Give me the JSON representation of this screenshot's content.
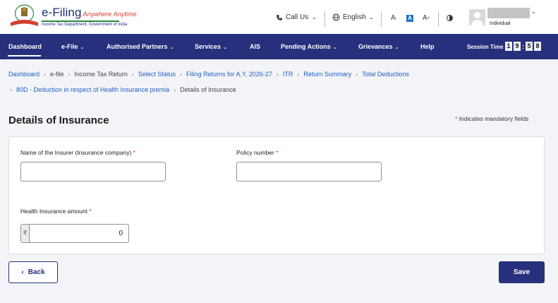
{
  "header": {
    "brand_title": "e-Filing",
    "brand_tagline": "Anywhere Anytime",
    "brand_subtitle": "Income Tax Department, Government of India",
    "call_us": "Call Us",
    "language": "English",
    "font_small": "A",
    "font_small_sup": "-",
    "font_normal": "A",
    "font_large": "A",
    "font_large_sup": "+",
    "user_role": "Individual"
  },
  "nav": {
    "items": [
      {
        "label": "Dashboard",
        "has_dropdown": false,
        "active": true
      },
      {
        "label": "e-File",
        "has_dropdown": true
      },
      {
        "label": "Authorised Partners",
        "has_dropdown": true
      },
      {
        "label": "Services",
        "has_dropdown": true
      },
      {
        "label": "AIS",
        "has_dropdown": false
      },
      {
        "label": "Pending Actions",
        "has_dropdown": true
      },
      {
        "label": "Grievances",
        "has_dropdown": true
      },
      {
        "label": "Help",
        "has_dropdown": false
      }
    ],
    "session_label": "Session Time",
    "session_digits": [
      "1",
      "9",
      "5",
      "8"
    ]
  },
  "breadcrumb": {
    "row1": [
      {
        "label": "Dashboard",
        "link": true
      },
      {
        "label": "e-file",
        "link": false
      },
      {
        "label": "Income Tax Return",
        "link": false
      },
      {
        "label": "Select Status",
        "link": true
      },
      {
        "label": "Filing Returns for A.Y. 2026-27",
        "link": true
      },
      {
        "label": "ITR",
        "link": true
      },
      {
        "label": "Return Summary",
        "link": true
      },
      {
        "label": "Total Deductions",
        "link": true
      }
    ],
    "row2": [
      {
        "label": "80D - Deduction in respect of Health Insurance premia",
        "link": true
      },
      {
        "label": "Details of Insurance",
        "link": false
      }
    ]
  },
  "page": {
    "title": "Details of Insurance",
    "mandatory_star": "*",
    "mandatory_note": "Indicates mandatory fields"
  },
  "form": {
    "insurer_label": "Name of the Insurer (Insurance company)",
    "insurer_value": "",
    "policy_label": "Policy number",
    "policy_value": "",
    "amount_label": "Health Insurance amount",
    "currency_symbol": "₹",
    "amount_value": "0",
    "required_marker": "*"
  },
  "actions": {
    "back_label": "Back",
    "save_label": "Save"
  },
  "colors": {
    "nav_bg": "#26307c",
    "link": "#1e5fbf",
    "required": "#d32f2f"
  }
}
